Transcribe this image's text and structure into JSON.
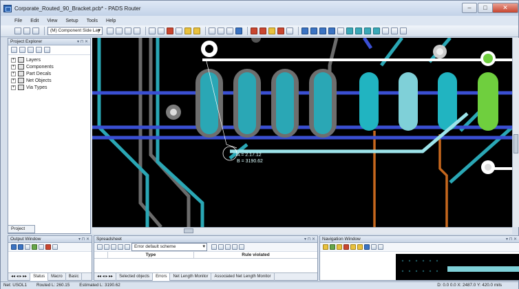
{
  "window": {
    "title": "Corporate_Routed_90_Bracket.pcb* - PADS Router"
  },
  "menu": [
    "File",
    "Edit",
    "View",
    "Setup",
    "Tools",
    "Help"
  ],
  "toolbar": {
    "layer_combo": "(M) Component Side Lay"
  },
  "project_explorer": {
    "title": "Project Explorer",
    "tree": [
      "Layers",
      "Components",
      "Part Decals",
      "Net Objects",
      "Via Types"
    ],
    "tab": "Project"
  },
  "canvas": {
    "dimension_labels": [
      "A = 2.17.12",
      "B = 3190.62"
    ],
    "colors": {
      "background": "#000000",
      "blue_trace": "#3a4fd2",
      "teal_trace": "#2ab3c0",
      "grey_trace": "#6e6e6e",
      "green_pad": "#6fcf3e",
      "orange_trace": "#c9681e"
    }
  },
  "output_window": {
    "title": "Output Window",
    "tabs": [
      "Status",
      "Macro",
      "Basic"
    ]
  },
  "spreadsheet": {
    "title": "Spreadsheet",
    "scheme": "Error default scheme",
    "columns": [
      "Type",
      "Rule violated"
    ],
    "tabs": [
      "Selected objects",
      "Errors",
      "Net Length Monitor",
      "Associated Net Length Monitor"
    ],
    "active_tab": "Errors"
  },
  "navigation_window": {
    "title": "Navigation Window"
  },
  "status": {
    "net": "Net: USOL1",
    "routed": "Routed L: 260.15",
    "estimated": "Estimated L: 3190.62",
    "coords": "D: 0.0 0.0  X: 2487.0  Y: 420.0  mils"
  }
}
